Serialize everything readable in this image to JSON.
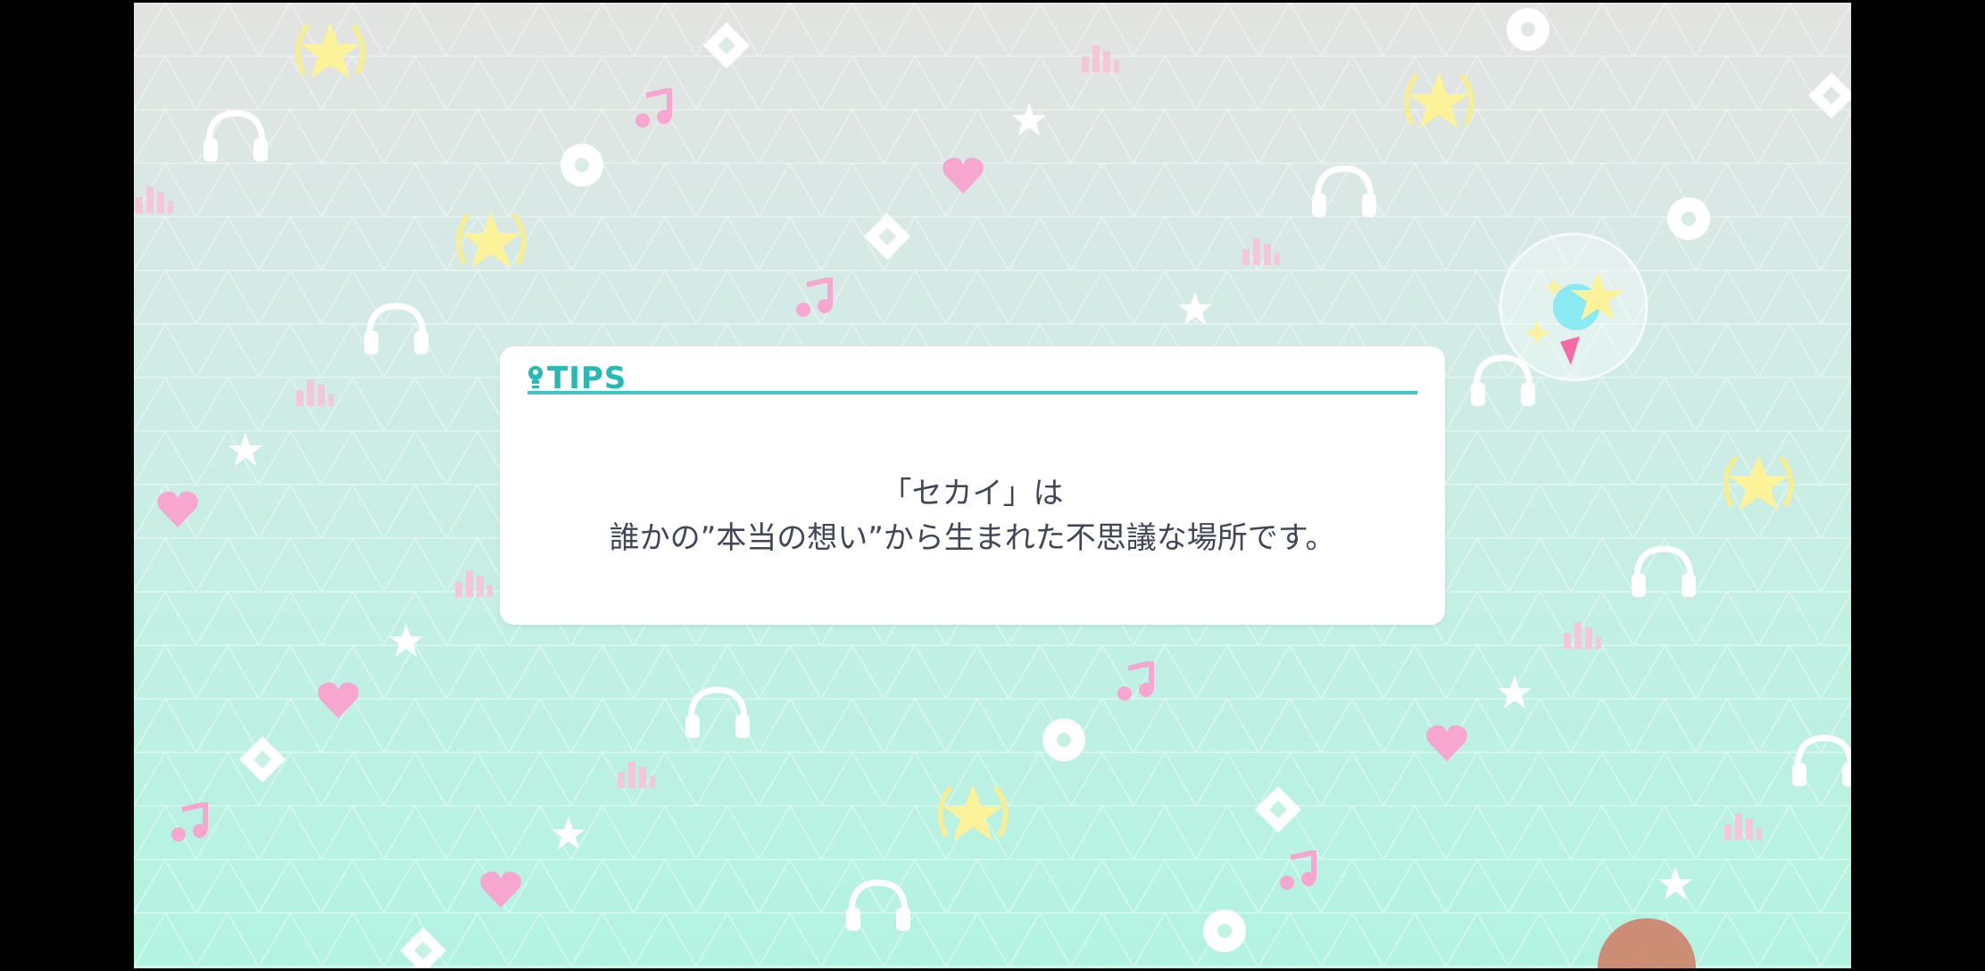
{
  "tips": {
    "heading": "TIPS",
    "icon": "lightbulb-icon",
    "line1": "「セカイ」は",
    "line2": "誰かの”本当の想い”から生まれた不思議な場所です。"
  },
  "colors": {
    "accent": "#3fc8c2",
    "text": "#3f4656",
    "bg_top": "#e3e3e1",
    "bg_bottom": "#b3f3e2",
    "pink": "#f7a7cf",
    "yellow": "#fbf29a"
  },
  "decorations": [
    "headphones-icon",
    "disc-icon",
    "music-note-icon",
    "star-icon",
    "heart-icon",
    "diamond-icon",
    "equalizer-icon",
    "laurel-star-icon"
  ]
}
